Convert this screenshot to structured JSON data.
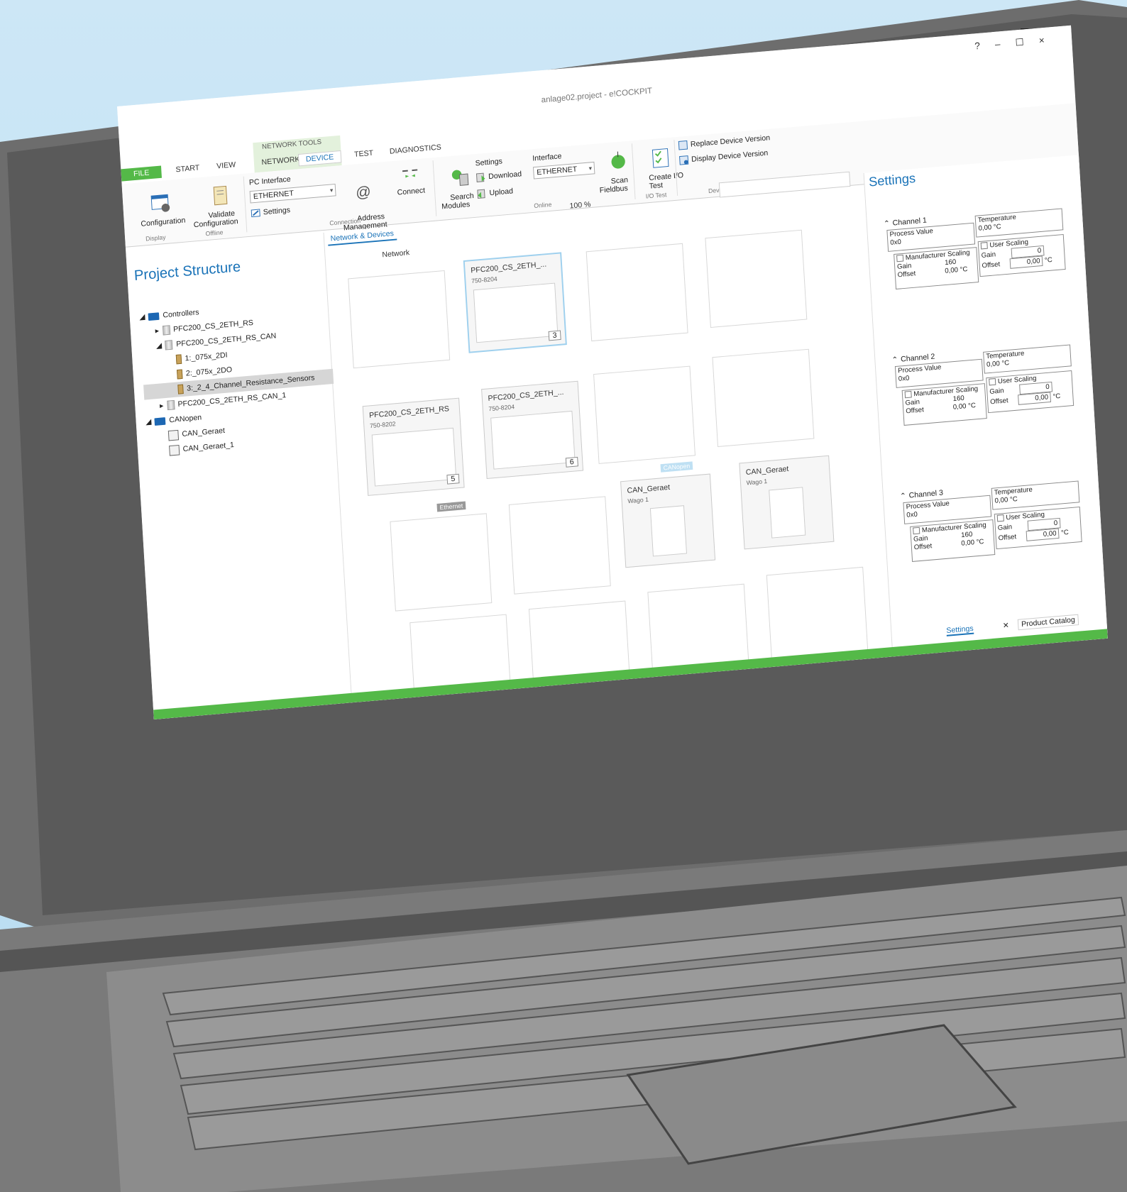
{
  "window": {
    "title": "anlage02.project - e!COCKPIT",
    "controls": [
      "?",
      "–",
      "☐",
      "×"
    ]
  },
  "ribbon": {
    "context_group": "NETWORK TOOLS",
    "tabs": [
      "FILE",
      "START",
      "VIEW",
      "NETWORK",
      "DEVICE",
      "TEST",
      "DIAGNOSTICS"
    ],
    "buttons": {
      "configuration": "Configuration",
      "validate_configuration": "Validate\nConfiguration",
      "pc_interface_label": "PC Interface",
      "pc_interface_value": "ETHERNET",
      "settings": "Settings",
      "address_management": "Address\nManagement",
      "connect": "Connect",
      "search_modules": "Search\nModules",
      "settings2": "Settings",
      "download": "Download",
      "upload": "Upload",
      "interface_label": "Interface",
      "interface_value": "ETHERNET",
      "scan_fieldbus": "Scan\nFieldbus",
      "create_io_test": "Create I/O\nTest",
      "replace_device_version": "Replace Device Version",
      "display_device_version": "Display Device Version"
    },
    "groups": {
      "display": "Display",
      "offline": "Offline",
      "connection": "Connection",
      "online": "Online",
      "io_test": "I/O Test",
      "device_driver": "Device Driver"
    }
  },
  "project_structure": {
    "title": "Project Structure",
    "tree": [
      {
        "label": "Controllers",
        "level": 0,
        "kind": "folder"
      },
      {
        "label": "PFC200_CS_2ETH_RS",
        "level": 1,
        "kind": "device"
      },
      {
        "label": "PFC200_CS_2ETH_RS_CAN",
        "level": 1,
        "kind": "device"
      },
      {
        "label": "1:_075x_2DI",
        "level": 2,
        "kind": "module"
      },
      {
        "label": "2:_075x_2DO",
        "level": 2,
        "kind": "module"
      },
      {
        "label": "3:_2_4_Channel_Resistance_Sensors",
        "level": 2,
        "kind": "module",
        "selected": true
      },
      {
        "label": "PFC200_CS_2ETH_RS_CAN_1",
        "level": 1,
        "kind": "device"
      },
      {
        "label": "CANopen",
        "level": 0,
        "kind": "folder"
      },
      {
        "label": "CAN_Geraet",
        "level": 1,
        "kind": "can"
      },
      {
        "label": "CAN_Geraet_1",
        "level": 1,
        "kind": "can"
      }
    ]
  },
  "network_view": {
    "tab": "Network & Devices",
    "breadcrumb": "Network",
    "zoom": "100 %",
    "devices": [
      {
        "name": "PFC200_CS_2ETH_...",
        "part": "750-8204",
        "number": "3"
      },
      {
        "name": "PFC200_CS_2ETH_RS",
        "part": "750-8202",
        "number": "5"
      },
      {
        "name": "PFC200_CS_2ETH_...",
        "part": "750-8204",
        "number": "6"
      },
      {
        "name": "CAN_Geraet",
        "part": "Wago 1"
      },
      {
        "name": "CAN_Geraet",
        "part": "Wago 1"
      }
    ],
    "bus_ethernet": "Ethernet",
    "bus_canopen": "CANopen"
  },
  "settings_panel": {
    "title": "Settings",
    "channels": [
      {
        "name": "Channel 1",
        "process_value_label": "Process Value",
        "process_value": "0x0",
        "temperature_label": "Temperature",
        "temperature": "0,00 °C",
        "manufacturer_scaling": "Manufacturer Scaling",
        "user_scaling": "User Scaling",
        "gain_label": "Gain",
        "offset_label": "Offset",
        "gain": "160",
        "offset": "0,00 °C",
        "user_gain": "0",
        "user_offset": "0,00",
        "unit": "°C"
      },
      {
        "name": "Channel 2",
        "process_value_label": "Process Value",
        "process_value": "0x0",
        "temperature_label": "Temperature",
        "temperature": "0,00 °C",
        "manufacturer_scaling": "Manufacturer Scaling",
        "user_scaling": "User Scaling",
        "gain_label": "Gain",
        "offset_label": "Offset",
        "gain": "160",
        "offset": "0,00 °C",
        "user_gain": "0",
        "user_offset": "0,00",
        "unit": "°C"
      },
      {
        "name": "Channel 3",
        "process_value_label": "Process Value",
        "process_value": "0x0",
        "temperature_label": "Temperature",
        "temperature": "0,00 °C",
        "manufacturer_scaling": "Manufacturer Scaling",
        "user_scaling": "User Scaling",
        "gain_label": "Gain",
        "offset_label": "Offset",
        "gain": "160",
        "offset": "0,00 °C",
        "user_gain": "0",
        "user_offset": "0,00",
        "unit": "°C"
      }
    ],
    "bottom_tabs": [
      "Settings",
      "Product Catalog"
    ]
  },
  "colors": {
    "accent_green": "#54b948",
    "title_blue": "#1a73b8",
    "selection": "#d6d6d6",
    "background": "#c4e3f5"
  }
}
